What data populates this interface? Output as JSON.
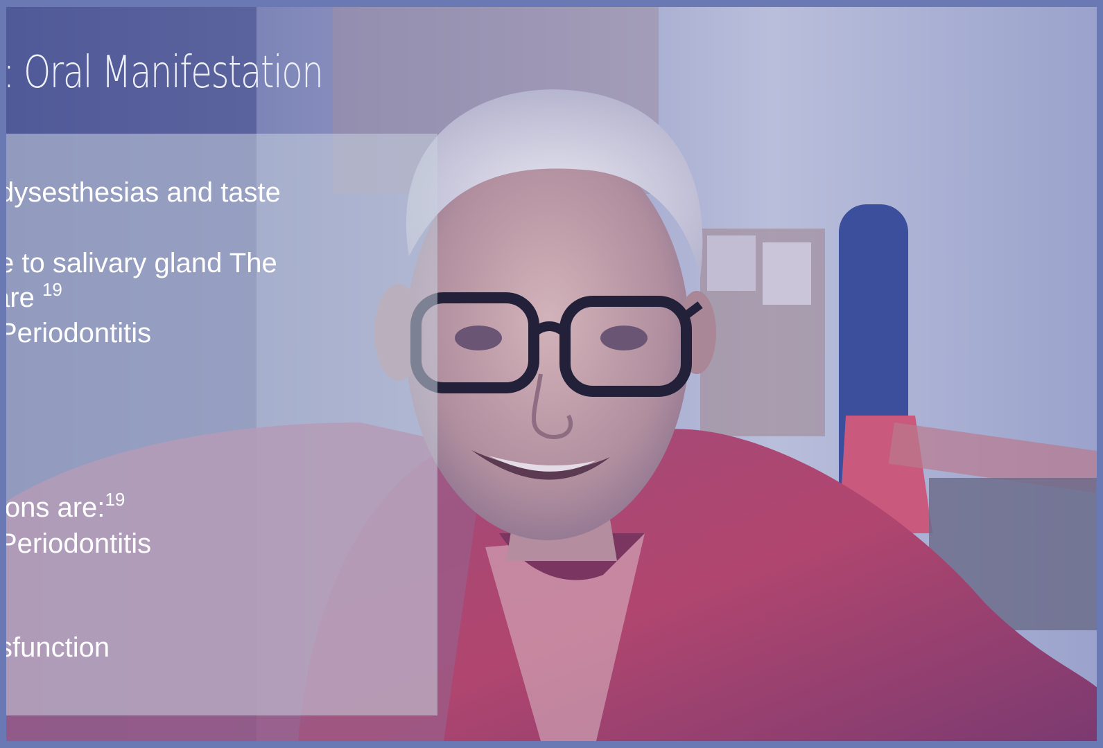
{
  "slide": {
    "title": "s: Oral Manifestation",
    "lines": [
      {
        "text": "dysesthesias and taste",
        "sup": ""
      },
      {
        "text": "e to salivary gland The",
        "sup": ""
      },
      {
        "text": " are ",
        "sup": "19"
      },
      {
        "text": "Periodontitis",
        "sup": ""
      },
      {
        "text": "ions are:",
        "sup": "19"
      },
      {
        "text": "Periodontitis",
        "sup": ""
      },
      {
        "text": "sfunction",
        "sup": ""
      }
    ]
  },
  "colors": {
    "frame": "#6a78b4",
    "panel": "#c8d2de",
    "text": "#ffffff"
  },
  "image": {
    "subject": "smiling-elderly-man-with-glasses-photo"
  }
}
